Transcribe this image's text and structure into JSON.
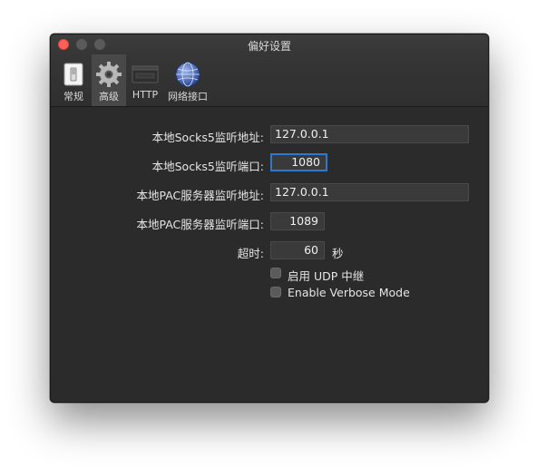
{
  "window": {
    "title": "偏好设置"
  },
  "toolbar": {
    "items": [
      {
        "label": "常规",
        "icon": "switch-icon"
      },
      {
        "label": "高级",
        "icon": "gear-icon"
      },
      {
        "label": "HTTP",
        "icon": "http-icon"
      },
      {
        "label": "网络接口",
        "icon": "network-globe-icon"
      }
    ],
    "active_index": 1
  },
  "form": {
    "socks5_address": {
      "label": "本地Socks5监听地址:",
      "value": "127.0.0.1"
    },
    "socks5_port": {
      "label": "本地Socks5监听端口:",
      "value": "1080"
    },
    "pac_address": {
      "label": "本地PAC服务器监听地址:",
      "value": "127.0.0.1"
    },
    "pac_port": {
      "label": "本地PAC服务器监听端口:",
      "value": "1089"
    },
    "timeout": {
      "label": "超时:",
      "value": "60",
      "unit": "秒"
    },
    "enable_udp_relay": {
      "label": "启用 UDP 中继",
      "checked": false
    },
    "enable_verbose": {
      "label": "Enable Verbose Mode",
      "checked": false
    }
  },
  "colors": {
    "close_button": "#fe5f57",
    "focus_ring": "#2b79d0",
    "window_bg": "#2b2b2b"
  }
}
